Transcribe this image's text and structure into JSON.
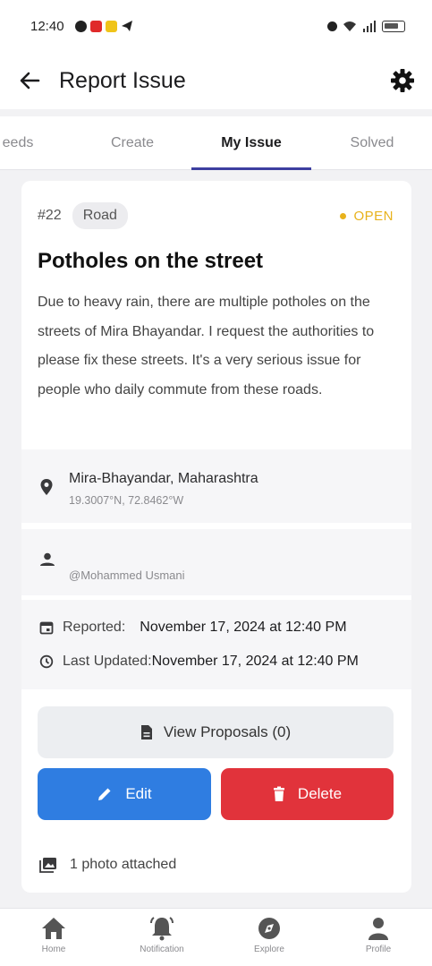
{
  "status_bar": {
    "time": "12:40"
  },
  "app_bar": {
    "title": "Report Issue"
  },
  "tabs": [
    {
      "label": "eeds"
    },
    {
      "label": "Create"
    },
    {
      "label": "My Issue"
    },
    {
      "label": "Solved"
    }
  ],
  "active_tab": "My Issue",
  "issue": {
    "number": "#22",
    "category": "Road",
    "status": "OPEN",
    "title": "Potholes on the street",
    "description": "Due to heavy rain, there are multiple potholes on the streets of Mira Bhayandar. I request the authorities to please fix these streets. It's a very serious issue for people who daily commute from these roads.",
    "location_name": "Mira-Bhayandar, Maharashtra",
    "location_coords": "19.3007°N, 72.8462°W",
    "reporter": "@Mohammed Usmani",
    "reported_label": "Reported:",
    "reported_value": "November 17, 2024 at 12:40 PM",
    "updated_label": "Last Updated:",
    "updated_value": "November 17, 2024 at 12:40 PM",
    "attachments": "1 photo attached"
  },
  "actions": {
    "view_proposals": "View Proposals (0)",
    "edit": "Edit",
    "delete": "Delete"
  },
  "bottom_nav": [
    {
      "label": "Home",
      "icon": "home-icon"
    },
    {
      "label": "Notification",
      "icon": "bell-icon"
    },
    {
      "label": "Explore",
      "icon": "compass-icon"
    },
    {
      "label": "Profile",
      "icon": "person-icon"
    }
  ],
  "colors": {
    "accent": "#3d3fa0",
    "status_open": "#e8b21c",
    "edit_button": "#2f7de1",
    "delete_button": "#e1333b"
  }
}
